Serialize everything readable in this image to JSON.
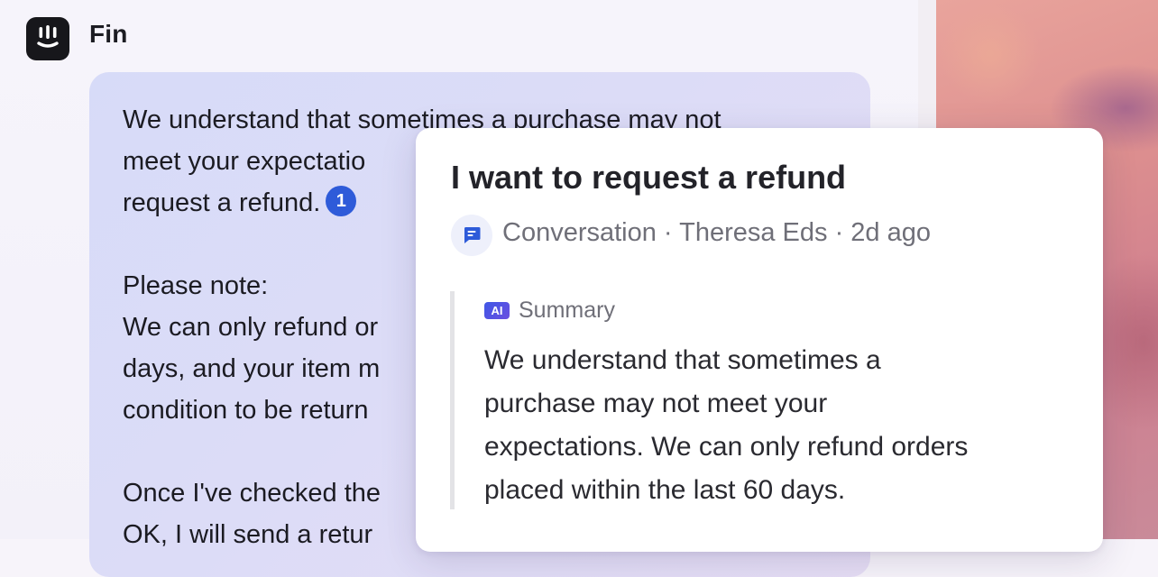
{
  "app": {
    "name": "Fin"
  },
  "message": {
    "lines": [
      "We understand that sometimes a purchase may not",
      "meet your expectatio",
      "request a refund.",
      "Please note:",
      "We can only refund or",
      "days, and your item m",
      "condition to be return",
      "Once I've checked the",
      "OK, I will send a retur"
    ],
    "citation_number": "1"
  },
  "source_card": {
    "title": "I want to request a refund",
    "meta": "Conversation · Theresa Eds · 2d ago",
    "icon": "conversation-icon",
    "summary_badge": "AI",
    "summary_label": "Summary",
    "summary_lines": [
      "We understand that sometimes a",
      "purchase may not meet your",
      "expectations. We can only refund orders",
      "placed within the last 60 days."
    ]
  },
  "colors": {
    "citation": "#2e5bd9",
    "ai_badge": "#4a55e4",
    "logo_bg": "#17171b"
  }
}
